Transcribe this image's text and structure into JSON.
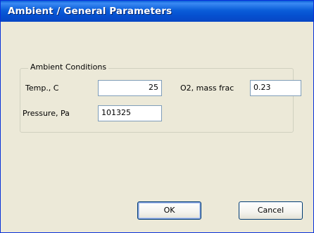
{
  "dialog": {
    "title": "Ambient / General Parameters"
  },
  "ambient": {
    "group_label": "Ambient Conditions",
    "temp_label": "Temp., C",
    "temp_value": "25",
    "o2_label": "O2, mass frac",
    "o2_value": "0.23",
    "pressure_label": "Pressure, Pa",
    "pressure_value": "101325"
  },
  "buttons": {
    "ok_label": "OK",
    "cancel_label": "Cancel"
  },
  "colors": {
    "titlebar": "#0550d0",
    "dialog_background": "#ece9d8",
    "field_border": "#7f9db9",
    "button_border": "#003c74"
  }
}
